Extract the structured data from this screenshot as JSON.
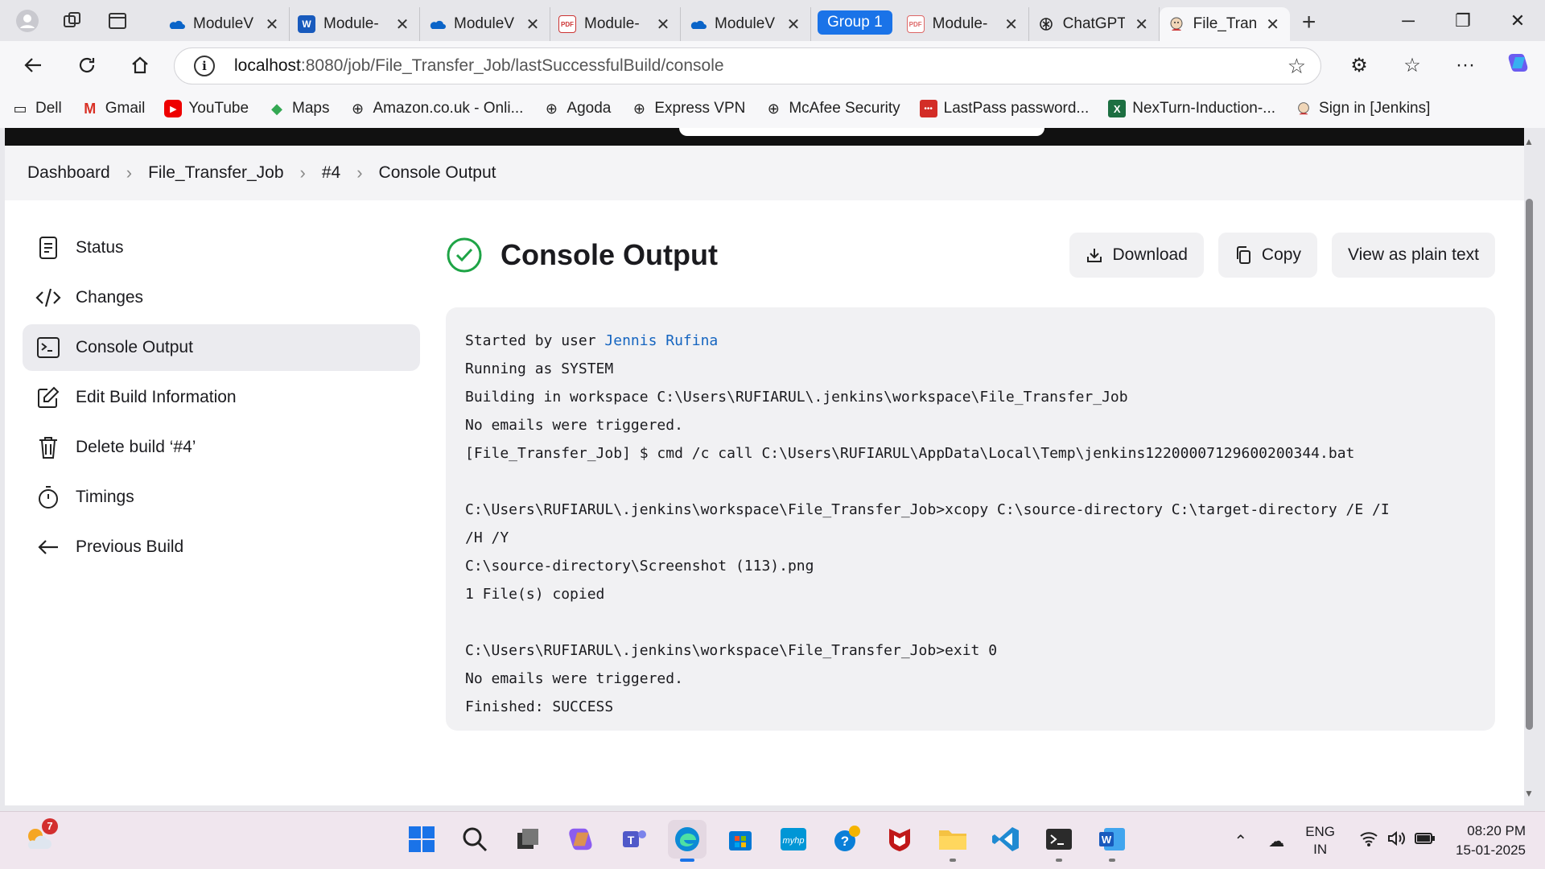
{
  "browser": {
    "tabs": [
      {
        "label": "ModuleV",
        "favicon": "onedrive-icon"
      },
      {
        "label": "Module-",
        "favicon": "word-icon"
      },
      {
        "label": "ModuleV",
        "favicon": "onedrive-icon"
      },
      {
        "label": "Module-",
        "favicon": "pdf-icon"
      },
      {
        "label": "ModuleV",
        "favicon": "onedrive-icon"
      },
      {
        "label": "Module-",
        "favicon": "pdf-icon"
      },
      {
        "label": "ChatGPT",
        "favicon": "chatgpt-icon"
      },
      {
        "label": "File_Tran",
        "favicon": "jenkins-icon"
      }
    ],
    "group_label": "Group 1",
    "url_host": "localhost",
    "url_rest": ":8080/job/File_Transfer_Job/lastSuccessfulBuild/console",
    "bookmarks": [
      "Dell",
      "Gmail",
      "YouTube",
      "Maps",
      "Amazon.co.uk - Onli...",
      "Agoda",
      "Express VPN",
      "McAfee Security",
      "LastPass password...",
      "NexTurn-Induction-...",
      "Sign in [Jenkins]"
    ]
  },
  "breadcrumb": [
    "Dashboard",
    "File_Transfer_Job",
    "#4",
    "Console Output"
  ],
  "sidebar": {
    "items": [
      {
        "label": "Status"
      },
      {
        "label": "Changes"
      },
      {
        "label": "Console Output"
      },
      {
        "label": "Edit Build Information"
      },
      {
        "label": "Delete build ‘#4’"
      },
      {
        "label": "Timings"
      },
      {
        "label": "Previous Build"
      }
    ]
  },
  "main": {
    "title": "Console Output",
    "actions": {
      "download": "Download",
      "copy": "Copy",
      "plain": "View as plain text"
    },
    "console": {
      "started_prefix": "Started by user ",
      "user": "Jennis Rufina",
      "body": "Running as SYSTEM\nBuilding in workspace C:\\Users\\RUFIARUL\\.jenkins\\workspace\\File_Transfer_Job\nNo emails were triggered.\n[File_Transfer_Job] $ cmd /c call C:\\Users\\RUFIARUL\\AppData\\Local\\Temp\\jenkins12200007129600200344.bat\n\nC:\\Users\\RUFIARUL\\.jenkins\\workspace\\File_Transfer_Job>xcopy C:\\source-directory C:\\target-directory /E /I\n/H /Y\nC:\\source-directory\\Screenshot (113).png\n1 File(s) copied\n\nC:\\Users\\RUFIARUL\\.jenkins\\workspace\\File_Transfer_Job>exit 0\nNo emails were triggered.\nFinished: SUCCESS"
    }
  },
  "taskbar": {
    "weather_badge": "7",
    "lang_line1": "ENG",
    "lang_line2": "IN",
    "time": "08:20 PM",
    "date": "15-01-2025"
  },
  "colors": {
    "accent": "#1a73e8",
    "success": "#1ea446",
    "link": "#1565c0"
  }
}
